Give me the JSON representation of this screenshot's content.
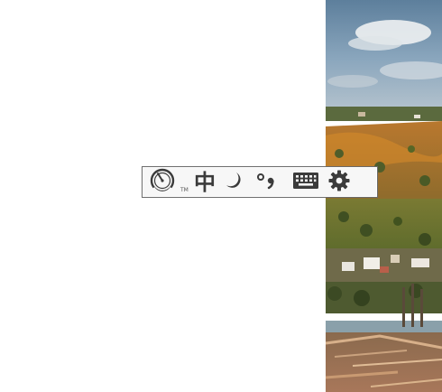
{
  "toolbar": {
    "logo": {
      "icon": "speedometer-logo-icon",
      "trademark": "TM"
    },
    "language": {
      "icon": "chinese-mode-icon",
      "label": "中"
    },
    "width_mode": {
      "icon": "half-width-moon-icon"
    },
    "punctuation": {
      "icon": "punctuation-mode-icon"
    },
    "keyboard": {
      "icon": "soft-keyboard-icon"
    },
    "settings": {
      "icon": "gear-icon"
    }
  },
  "colors": {
    "toolbar_bg": "#f7f7f7",
    "toolbar_border": "#6b6b6b",
    "icon": "#3b3b3b"
  }
}
